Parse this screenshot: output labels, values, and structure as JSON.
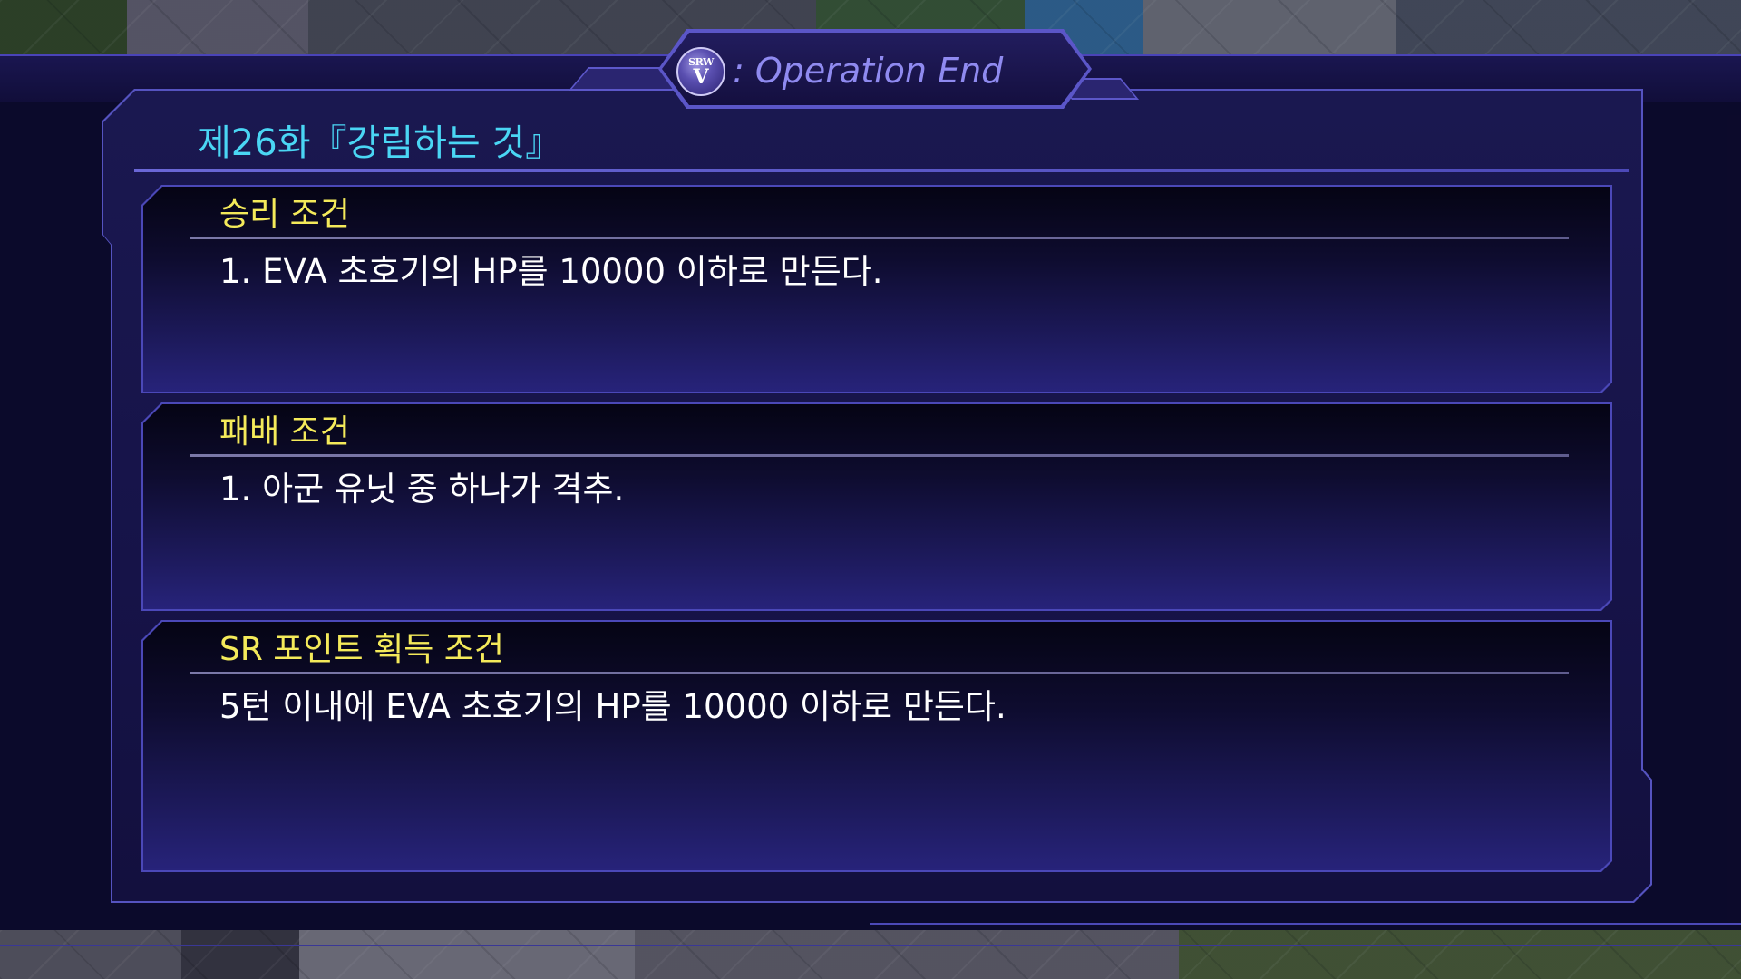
{
  "header": {
    "logo_top": "SRW",
    "logo_bottom": "V",
    "title": ": Operation End"
  },
  "chapter": {
    "title": "제26화『강림하는 것』"
  },
  "conditions": [
    {
      "heading": "승리 조건",
      "text": "1. EVA 초호기의 HP를 10000 이하로 만든다."
    },
    {
      "heading": "패배 조건",
      "text": "1. 아군 유닛 중 하나가 격추."
    },
    {
      "heading": "SR 포인트 획득 조건",
      "text": "5턴 이내에 EVA 초호기의 HP를 10000 이하로 만든다."
    }
  ],
  "colors": {
    "chapter_title": "#4ad6f4",
    "panel_heading": "#f4ea5a",
    "body_text": "#ffffff",
    "frame_border": "#5553c0",
    "header_title": "#8f8af0"
  }
}
